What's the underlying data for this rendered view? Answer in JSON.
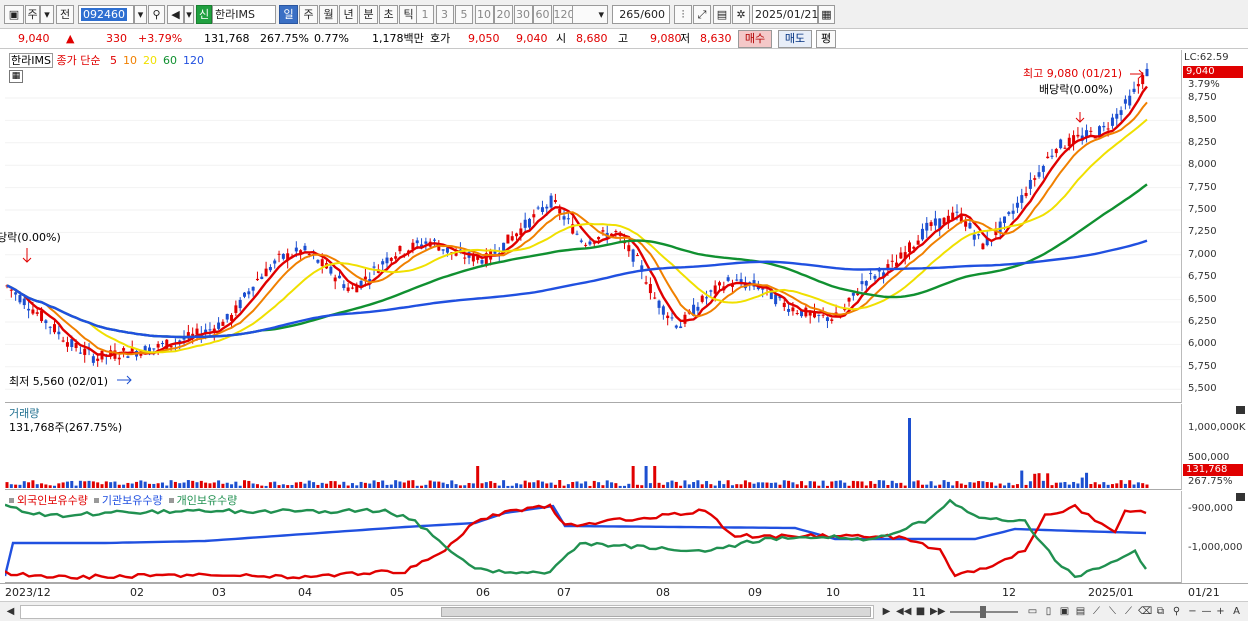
{
  "toolbar": {
    "period_main": "주",
    "prev_label": "전",
    "stock_code": "092460",
    "credit_badge": "신",
    "stock_name": "한라IMS",
    "period_tabs": [
      "일",
      "주",
      "월",
      "년",
      "분",
      "초",
      "틱"
    ],
    "active_period": "일",
    "interval_buttons": [
      "1",
      "3",
      "5",
      "10",
      "20",
      "30",
      "60",
      "120"
    ],
    "count_value": "265",
    "count_total": "/600",
    "date_value": "2025/01/21"
  },
  "quote": {
    "price": "9,040",
    "change": "330",
    "change_pct": "+3.79%",
    "volume": "131,768",
    "volume_ratio": "267.75%",
    "turnover": "0.77%",
    "amount": "1,178백만",
    "hoga_label": "호가",
    "ask": "9,050",
    "bid": "9,040",
    "open_label": "시",
    "open": "8,680",
    "high_label": "고",
    "high": "9,080",
    "low_label": "저",
    "low": "8,630",
    "buy_button": "매수",
    "sell_button": "매도",
    "eval_button": "평"
  },
  "price_panel": {
    "title": "한라IMS",
    "legend_label": "종가 단순",
    "ma_periods": [
      "5",
      "10",
      "20",
      "60",
      "120"
    ],
    "ma_colors": [
      "#e00000",
      "#f08000",
      "#f0e000",
      "#109030",
      "#2050e0"
    ],
    "lc_label": "LC:62.59",
    "last_price": "9,040",
    "last_pct": "3.79%",
    "axis_labels": [
      "8,750",
      "8,500",
      "8,250",
      "8,000",
      "7,750",
      "7,500",
      "7,250",
      "7,000",
      "6,750",
      "6,500",
      "6,250",
      "6,000",
      "5,750",
      "5,500"
    ],
    "high_note": "최고 9,080 (01/21)",
    "dividend_note": "배당락(0.00%)",
    "dividend_note_left": "당락(0.00%)",
    "low_note": "최저 5,560 (02/01)"
  },
  "volume_panel": {
    "title": "거래량",
    "value_line": "131,768주(267.75%)",
    "axis_labels": [
      "1,000,000K",
      "500,000"
    ],
    "last_value": "131,768",
    "last_pct": "267.75%"
  },
  "holdings_panel": {
    "legend": [
      "외국인보유수량",
      "기관보유수량",
      "개인보유수량"
    ],
    "legend_colors": [
      "#e00000",
      "#2050e0",
      "#209050"
    ],
    "axis_labels": [
      "-900,000",
      "-1,000,000"
    ]
  },
  "x_axis": {
    "labels": [
      "2023/12",
      "02",
      "03",
      "04",
      "05",
      "06",
      "07",
      "08",
      "09",
      "10",
      "11",
      "12",
      "2025/01"
    ],
    "right_label": "01/21"
  }
}
